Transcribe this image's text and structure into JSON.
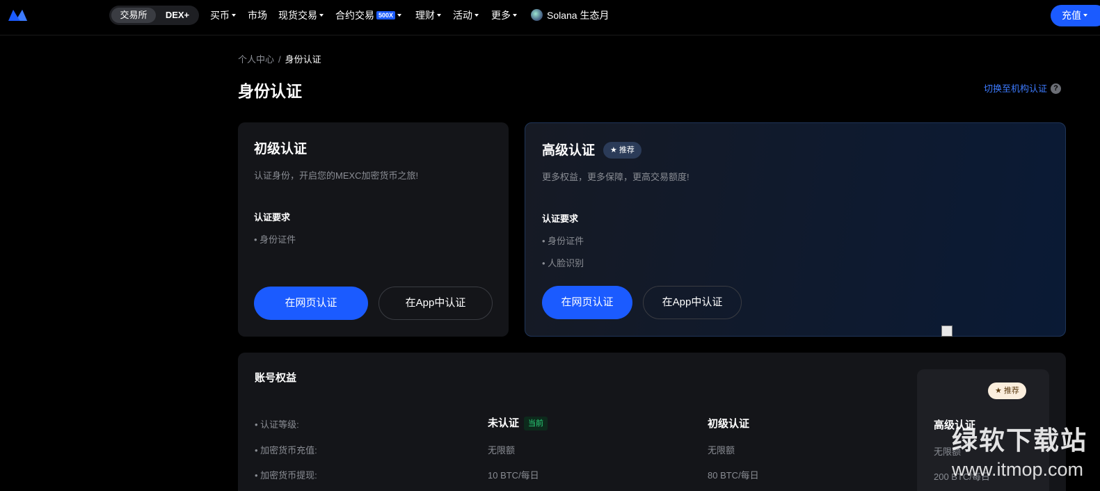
{
  "nav": {
    "switch": {
      "exchange": "交易所",
      "dex": "DEX+"
    },
    "items": [
      "买币",
      "市场",
      "现货交易",
      "合约交易",
      "理财",
      "活动",
      "更多"
    ],
    "futures_badge": "500X",
    "solana": "Solana 生态月",
    "deposit": "充值"
  },
  "breadcrumb": {
    "home": "个人中心",
    "sep": "/",
    "current": "身份认证"
  },
  "page": {
    "title": "身份认证",
    "org_link": "切换至机构认证",
    "help_glyph": "?"
  },
  "basic_card": {
    "title": "初级认证",
    "subtitle": "认证身份，开启您的MEXC加密货币之旅!",
    "req_title": "认证要求",
    "requirements": [
      "• 身份证件"
    ],
    "web_button": "在网页认证",
    "app_button": "在App中认证"
  },
  "advanced_card": {
    "title": "高级认证",
    "badge": "★ 推荐",
    "subtitle": "更多权益，更多保障，更高交易额度!",
    "req_title": "认证要求",
    "requirements": [
      "• 身份证件",
      "• 人脸识别"
    ],
    "web_button": "在网页认证",
    "app_button": "在App中认证"
  },
  "benefits": {
    "title": "账号权益",
    "badge": "★ 推荐",
    "row_labels": [
      "• 认证等级:",
      "• 加密货币充值:",
      "• 加密货币提现:"
    ],
    "levels": [
      "未认证",
      "初级认证",
      "高级认证"
    ],
    "current_tag": "当前",
    "columns": [
      {
        "deposit": "无限额",
        "withdraw": "10 BTC/每日"
      },
      {
        "deposit": "无限额",
        "withdraw": "80 BTC/每日"
      },
      {
        "deposit": "无限额",
        "withdraw": "200 BTC/每日"
      }
    ]
  },
  "watermark": {
    "title": "绿软下载站",
    "url": "www.itmop.com"
  },
  "colors": {
    "accent": "#1b5bff",
    "link": "#3d7bff",
    "success": "#2bd47b"
  }
}
